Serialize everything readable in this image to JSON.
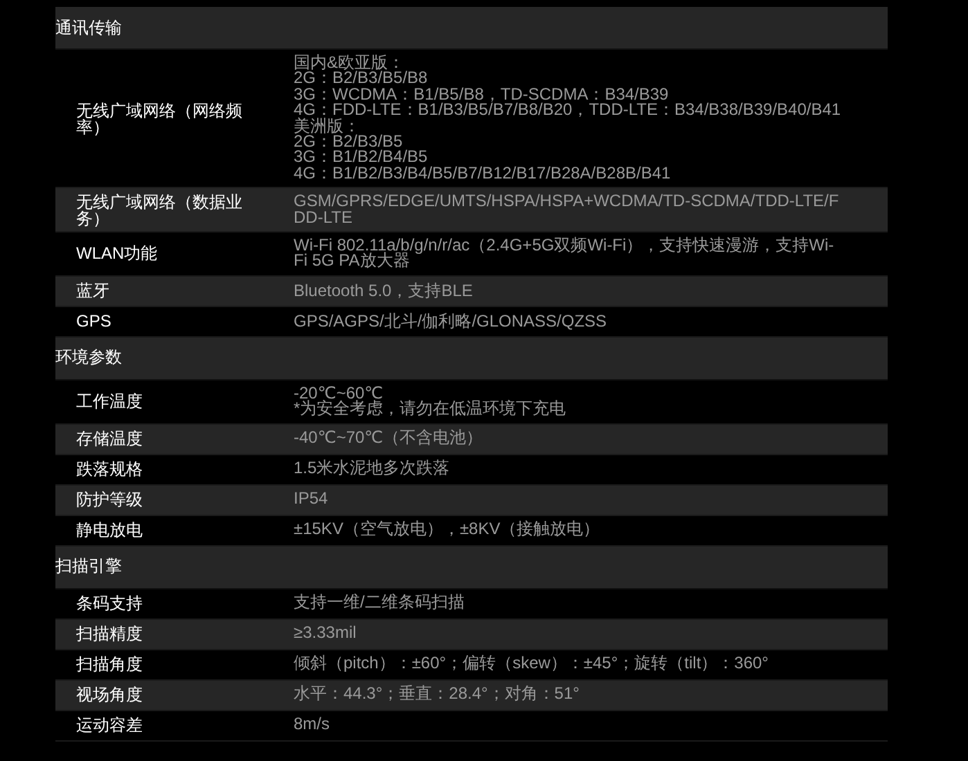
{
  "sections": [
    {
      "title": "通讯传输",
      "rows": [
        {
          "label": "无线广域网络（网络频率）",
          "value": [
            "国内&欧亚版：",
            "2G：B2/B3/B5/B8",
            "3G：WCDMA：B1/B5/B8，TD-SCDMA：B34/B39",
            "4G：FDD-LTE：B1/B3/B5/B7/B8/B20，TDD-LTE：B34/B38/B39/B40/B41",
            "美洲版：",
            "2G：B2/B3/B5",
            "3G：B1/B2/B4/B5",
            "4G：B1/B2/B3/B4/B5/B7/B12/B17/B28A/B28B/B41"
          ]
        },
        {
          "label": "无线广域网络（数据业务）",
          "value": [
            "GSM/GPRS/EDGE/UMTS/HSPA/HSPA+WCDMA/TD-SCDMA/TDD-LTE/F",
            "DD-LTE"
          ]
        },
        {
          "label": "WLAN功能",
          "value": [
            "Wi-Fi 802.11a/b/g/n/r/ac（2.4G+5G双频Wi-Fi），支持快速漫游，支持Wi-",
            "Fi 5G PA放大器"
          ]
        },
        {
          "label": "蓝牙",
          "value": [
            "Bluetooth 5.0，支持BLE"
          ]
        },
        {
          "label": "GPS",
          "value": [
            "GPS/AGPS/北斗/伽利略/GLONASS/QZSS"
          ]
        }
      ]
    },
    {
      "title": "环境参数",
      "rows": [
        {
          "label": "工作温度",
          "value": [
            "-20℃~60℃",
            "*为安全考虑，请勿在低温环境下充电"
          ]
        },
        {
          "label": "存储温度",
          "value": [
            "-40℃~70℃（不含电池）"
          ]
        },
        {
          "label": "跌落规格",
          "value": [
            "1.5米水泥地多次跌落"
          ]
        },
        {
          "label": "防护等级",
          "value": [
            "IP54"
          ]
        },
        {
          "label": "静电放电",
          "value": [
            "±15KV（空气放电），±8KV（接触放电）"
          ]
        }
      ]
    },
    {
      "title": "扫描引擎",
      "rows": [
        {
          "label": "条码支持",
          "value": [
            "支持一维/二维条码扫描"
          ]
        },
        {
          "label": "扫描精度",
          "value": [
            "≥3.33mil"
          ]
        },
        {
          "label": "扫描角度",
          "value": [
            "倾斜（pitch）：±60°；偏转（skew）：±45°；旋转（tilt）：360°"
          ]
        },
        {
          "label": "视场角度",
          "value": [
            "水平：44.3°；垂直：28.4°；对角：51°"
          ]
        },
        {
          "label": "运动容差",
          "value": [
            "8m/s"
          ]
        }
      ]
    }
  ]
}
